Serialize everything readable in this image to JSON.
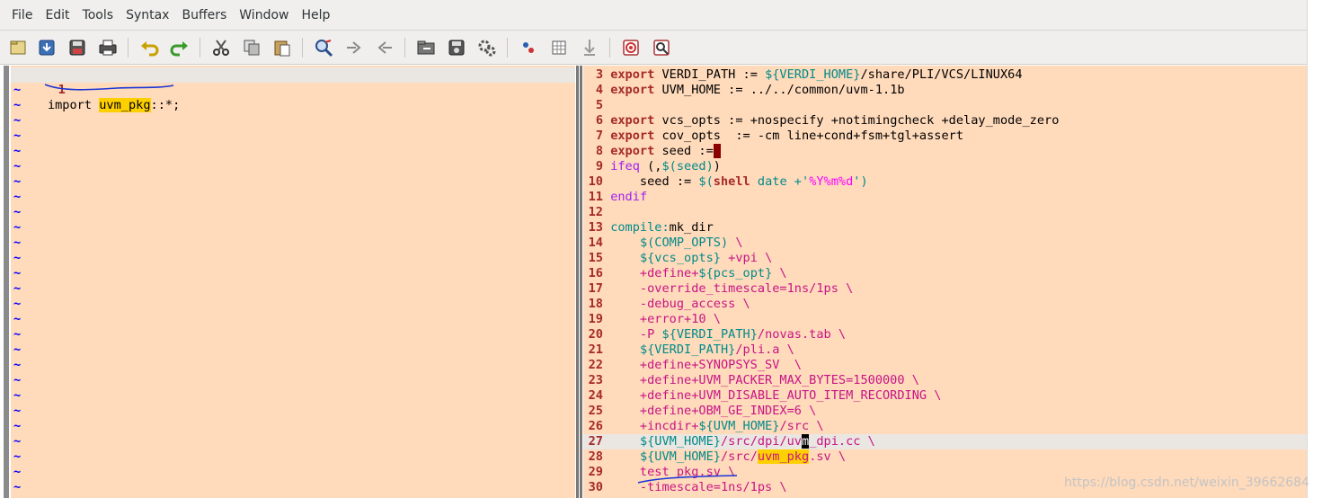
{
  "menubar": {
    "items": [
      "File",
      "Edit",
      "Tools",
      "Syntax",
      "Buffers",
      "Window",
      "Help"
    ]
  },
  "toolbar": {
    "buttons": [
      {
        "name": "open-file-icon"
      },
      {
        "name": "save-file-icon"
      },
      {
        "name": "save-all-icon"
      },
      {
        "name": "print-icon"
      },
      {
        "name": "undo-icon"
      },
      {
        "name": "redo-icon"
      },
      {
        "name": "cut-icon"
      },
      {
        "name": "copy-icon"
      },
      {
        "name": "paste-icon"
      },
      {
        "name": "find-replace-icon"
      },
      {
        "name": "find-next-icon"
      },
      {
        "name": "find-previous-icon"
      },
      {
        "name": "load-session-icon"
      },
      {
        "name": "save-session-icon"
      },
      {
        "name": "run-script-icon"
      },
      {
        "name": "make-icon"
      },
      {
        "name": "run-ctags-icon"
      },
      {
        "name": "jump-to-tag-icon"
      },
      {
        "name": "help-icon"
      },
      {
        "name": "find-help-icon"
      }
    ]
  },
  "left_pane": {
    "line1": {
      "num": "1",
      "t1": "import ",
      "t2": "uvm_pkg",
      "t3": "::*;"
    },
    "tilde": "~"
  },
  "right_pane": {
    "lines": [
      {
        "num": "3",
        "t1": "export",
        "t2": " VERDI_PATH := ",
        "t3": "${VERDI_HOME}",
        "t4": "/share/PLI/VCS/LINUX64"
      },
      {
        "num": "4",
        "t1": "export",
        "t2": " UVM_HOME := ../../common/uvm-1.1b"
      },
      {
        "num": "5"
      },
      {
        "num": "6",
        "t1": "export",
        "t2": " vcs_opts := +nospecify +notimingcheck +delay_mode_zero"
      },
      {
        "num": "7",
        "t1": "export",
        "t2": " cov_opts  := -cm line+cond+fsm+tgl+assert"
      },
      {
        "num": "8",
        "t1": "export",
        "t2": " seed :="
      },
      {
        "num": "9",
        "t1": "ifeq",
        "t2": " (,",
        "t3": "$(seed)",
        "t4": ")"
      },
      {
        "num": "10",
        "t1": "    seed := ",
        "t2": "$(",
        "t3": "shell",
        "t4": " date +'",
        "t5": "%Y%m%d",
        "t6": "')"
      },
      {
        "num": "11",
        "t1": "endif"
      },
      {
        "num": "12"
      },
      {
        "num": "13",
        "t1": "compile:",
        "t2": "mk_dir"
      },
      {
        "num": "14",
        "t1": "    ",
        "t2": "$(COMP_OPTS)",
        "t3": " \\"
      },
      {
        "num": "15",
        "t1": "    ",
        "t2": "${vcs_opts}",
        "t3": " +vpi",
        "t4": " \\"
      },
      {
        "num": "16",
        "t1": "    +define+",
        "t2": "${pcs_opt}",
        "t3": " \\"
      },
      {
        "num": "17",
        "t1": "    -override_timescale=1ns/1ps",
        "t2": " \\"
      },
      {
        "num": "18",
        "t1": "    -debug_access",
        "t2": " \\"
      },
      {
        "num": "19",
        "t1": "    +error+10",
        "t2": " \\"
      },
      {
        "num": "20",
        "t1": "    -P ",
        "t2": "${VERDI_PATH}",
        "t3": "/novas.tab",
        "t4": " \\"
      },
      {
        "num": "21",
        "t1": "    ",
        "t2": "${VERDI_PATH}",
        "t3": "/pli.a",
        "t4": " \\"
      },
      {
        "num": "22",
        "t1": "    +define+SYNOPSYS_SV",
        "t2": "  \\"
      },
      {
        "num": "23",
        "t1": "    +define+UVM_PACKER_MAX_BYTES=1500000",
        "t2": " \\"
      },
      {
        "num": "24",
        "t1": "    +define+UVM_DISABLE_AUTO_ITEM_RECORDING",
        "t2": " \\"
      },
      {
        "num": "25",
        "t1": "    +define+OBM_GE_INDEX=6",
        "t2": " \\"
      },
      {
        "num": "26",
        "t1": "    +incdir+",
        "t2": "${UVM_HOME}",
        "t3": "/src",
        "t4": " \\"
      },
      {
        "num": "27",
        "t1": "    ",
        "t2": "${UVM_HOME}",
        "t3": "/src/dpi/uv",
        "t4": "m",
        "t5": "_dpi.cc",
        "t6": " \\"
      },
      {
        "num": "28",
        "t1": "    ",
        "t2": "${UVM_HOME}",
        "t3": "/src/",
        "t4": "uvm_pkg",
        "t5": ".sv",
        "t6": " \\"
      },
      {
        "num": "29",
        "t1": "    test_pkg.sv",
        "t2": " \\"
      },
      {
        "num": "30",
        "t1": "    -timescale=1ns/1ps",
        "t2": " \\"
      }
    ]
  },
  "watermark": "https://blog.csdn.net/weixin_39662684",
  "colors": {
    "background": "#ffdabb",
    "line_number": "#a52a2a",
    "keyword": "#a52a2a",
    "variable": "#008b8b",
    "string": "#ff00ff",
    "search_highlight": "#ffd000",
    "annotation_ink": "#1a35d6"
  }
}
